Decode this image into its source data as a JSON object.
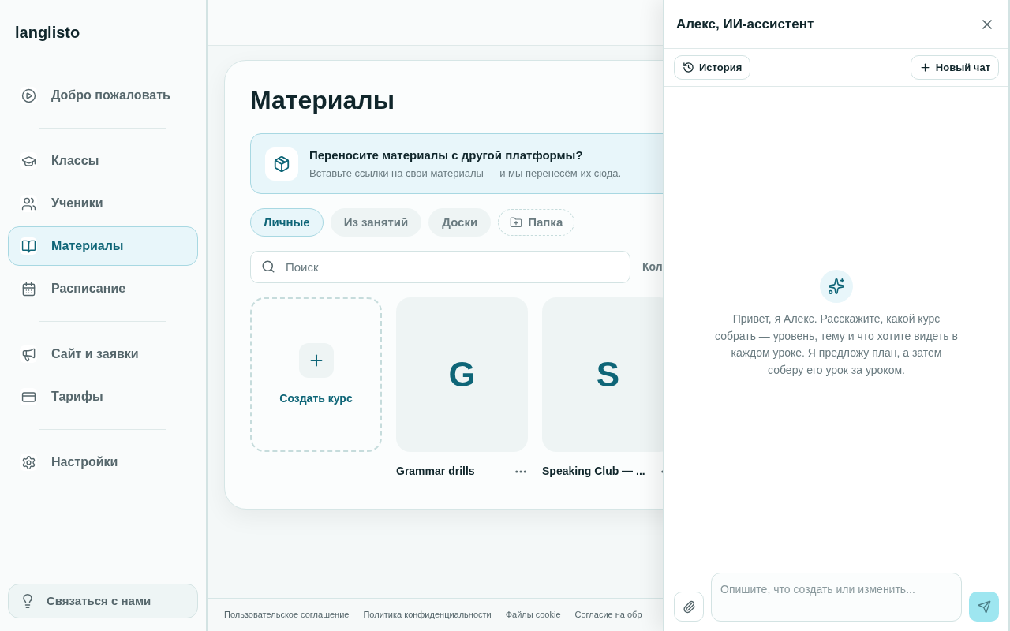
{
  "sidebar": {
    "logo": "langlisto",
    "nav_groups": [
      [
        {
          "label": "Добро пожаловать",
          "selected": false
        }
      ],
      [
        {
          "label": "Классы",
          "selected": false
        },
        {
          "label": "Ученики",
          "selected": false
        },
        {
          "label": "Материалы",
          "selected": true
        },
        {
          "label": "Расписание",
          "selected": false
        }
      ],
      [
        {
          "label": "Сайт и заявки",
          "selected": false
        },
        {
          "label": "Тарифы",
          "selected": false
        }
      ],
      [
        {
          "label": "Настройки",
          "selected": false
        }
      ]
    ],
    "contact_button": "Связаться с нами"
  },
  "main": {
    "title": "Материалы",
    "banner": {
      "title": "Переносите материалы с другой платформы?",
      "text": "Вставьте ссылки на свои материалы — и мы перенесём их сюда."
    },
    "filters": [
      {
        "label": "Личные",
        "selected": true
      },
      {
        "label": "Из занятий",
        "selected": false
      },
      {
        "label": "Доски",
        "selected": false
      }
    ],
    "new_folder_button": "Папка",
    "search": {
      "placeholder": "Поиск"
    },
    "sort_label": "Кол",
    "courses": [
      {
        "kind": "create",
        "label": "Создать курс"
      },
      {
        "kind": "course",
        "letter": "G",
        "title": "Grammar drills"
      },
      {
        "kind": "course",
        "letter": "S",
        "title": "Speaking Club — ..."
      }
    ],
    "footer_links": [
      "Пользовательское соглашение",
      "Политика конфиденциальности",
      "Файлы cookie",
      "Согласие на обр"
    ]
  },
  "assistant": {
    "title": "Алекс, ИИ-ассистент",
    "history_button": "История",
    "new_chat_button": "Новый чат",
    "greeting": "Привет, я Алекс. Расскажите, какой курс собрать — уровень, тему и что хотите видеть в каждом уроке. Я предложу план, а затем соберу его урок за уроком.",
    "input": {
      "placeholder": "Опишите, что создать или изменить..."
    }
  }
}
